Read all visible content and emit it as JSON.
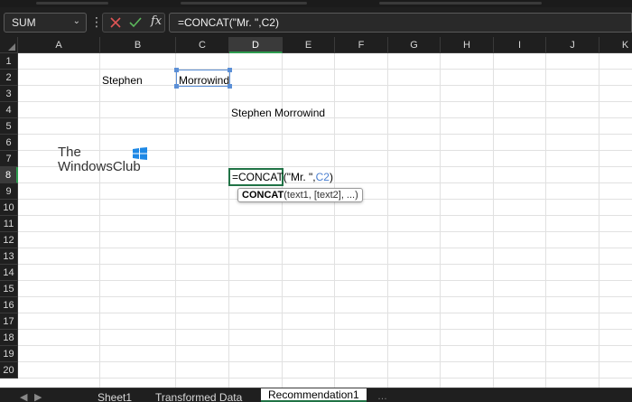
{
  "name_box": {
    "value": "SUM"
  },
  "formula_bar": {
    "value": "=CONCAT(\"Mr. \",C2)",
    "fx_label": "fx"
  },
  "columns": [
    "A",
    "B",
    "C",
    "D",
    "E",
    "F",
    "G",
    "H",
    "I",
    "J",
    "K"
  ],
  "rows": [
    "1",
    "2",
    "3",
    "4",
    "5",
    "6",
    "7",
    "8",
    "9",
    "10",
    "11",
    "12",
    "13",
    "14",
    "15",
    "16",
    "17",
    "18",
    "19",
    "20"
  ],
  "selected_column": "D",
  "selected_row": "8",
  "cells": {
    "B2": "Stephen",
    "C2": "Morrowind",
    "D4": "Stephen Morrowind"
  },
  "editor": {
    "prefix": "=CONCAT(\"Mr. \",",
    "ref": "C2",
    "suffix": ")"
  },
  "tooltip": {
    "func": "CONCAT",
    "args": "(text1, [text2], ...)"
  },
  "watermark": {
    "line1": "The",
    "line2": "WindowsClub"
  },
  "sheet_tabs": [
    "Sheet1",
    "Transformed Data",
    "Recommendation1"
  ],
  "active_tab": "Recommendation1",
  "colors": {
    "accent": "#217346",
    "ref": "#4a7fd0",
    "dark_bg": "#1f1f1f"
  }
}
